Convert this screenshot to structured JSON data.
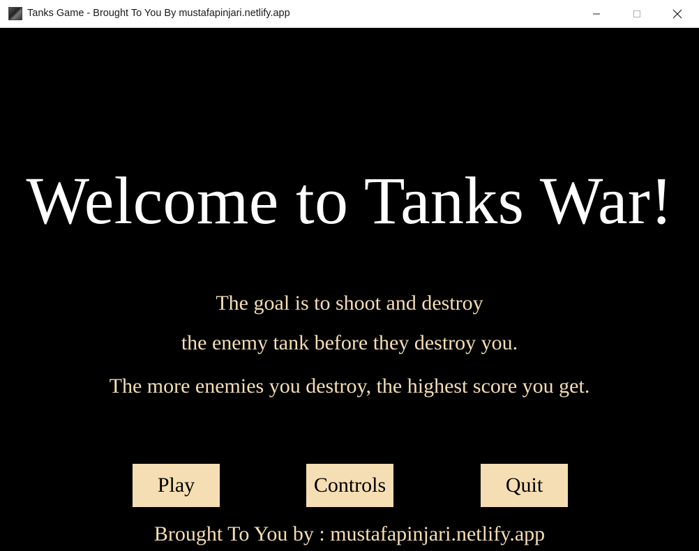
{
  "window": {
    "title": "Tanks Game - Brought To You By mustafapinjari.netlify.app",
    "icon": "tank-game-icon",
    "controls": {
      "minimize_icon": "minimize-icon",
      "maximize_icon": "maximize-icon",
      "close_icon": "close-icon"
    }
  },
  "game": {
    "headline": "Welcome to Tanks War!",
    "description": [
      "The goal is to shoot and destroy",
      "the enemy tank before they destroy you.",
      "The more enemies you destroy, the highest score you get."
    ],
    "buttons": {
      "play": "Play",
      "controls": "Controls",
      "quit": "Quit"
    },
    "credit": "Brought To You by : mustafapinjari.netlify.app"
  },
  "colors": {
    "background": "#000000",
    "headline": "#ffffff",
    "accent": "#f5deb3",
    "button_text": "#000000"
  }
}
